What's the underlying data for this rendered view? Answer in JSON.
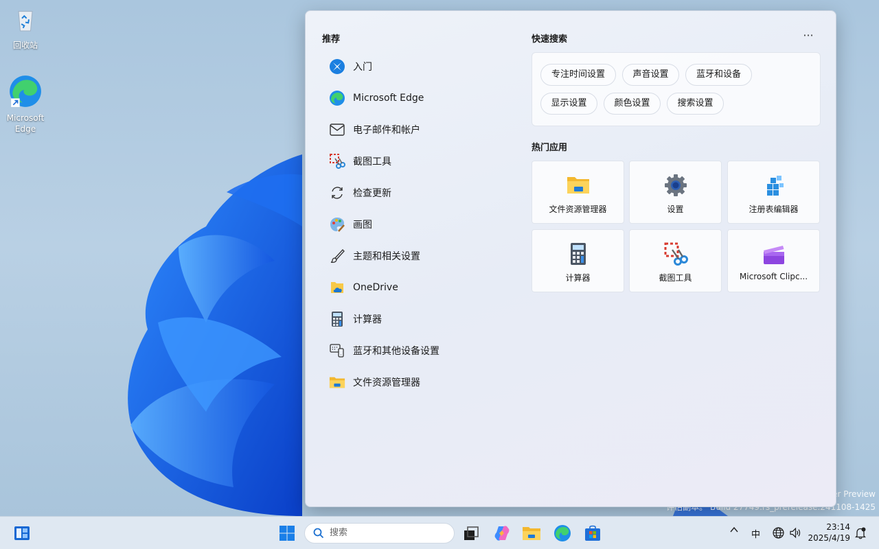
{
  "desktop": {
    "icons": [
      {
        "label": "回收站",
        "icon": "recycle-bin-icon"
      },
      {
        "label": "Microsoft Edge",
        "icon": "edge-shortcut-icon"
      }
    ],
    "watermark": {
      "line1": "er Preview",
      "line2": "评估副本。 Build 27749.rs_prerelease.241108-1425"
    }
  },
  "start_menu": {
    "recommended": {
      "title": "推荐",
      "items": [
        {
          "label": "入门",
          "icon": "get-started-icon"
        },
        {
          "label": "Microsoft Edge",
          "icon": "edge-icon"
        },
        {
          "label": "电子邮件和帐户",
          "icon": "mail-icon"
        },
        {
          "label": "截图工具",
          "icon": "snipping-tool-icon"
        },
        {
          "label": "检查更新",
          "icon": "refresh-icon"
        },
        {
          "label": "画图",
          "icon": "paint-icon"
        },
        {
          "label": "主题和相关设置",
          "icon": "brush-icon"
        },
        {
          "label": "OneDrive",
          "icon": "onedrive-icon"
        },
        {
          "label": "计算器",
          "icon": "calculator-icon"
        },
        {
          "label": "蓝牙和其他设备设置",
          "icon": "devices-icon"
        },
        {
          "label": "文件资源管理器",
          "icon": "folder-icon"
        }
      ]
    },
    "quick_search": {
      "title": "快速搜索",
      "more_label": "···",
      "pills": [
        "专注时间设置",
        "声音设置",
        "蓝牙和设备",
        "显示设置",
        "颜色设置",
        "搜索设置"
      ]
    },
    "hot_apps": {
      "title": "热门应用",
      "tiles": [
        {
          "label": "文件资源管理器",
          "icon": "folder-icon"
        },
        {
          "label": "设置",
          "icon": "gear-icon"
        },
        {
          "label": "注册表编辑器",
          "icon": "registry-editor-icon"
        },
        {
          "label": "计算器",
          "icon": "calculator-icon"
        },
        {
          "label": "截图工具",
          "icon": "snipping-tool-icon"
        },
        {
          "label": "Microsoft Clipc...",
          "icon": "clipchamp-icon"
        }
      ]
    }
  },
  "taskbar": {
    "search_placeholder": "搜索",
    "ime_label": "中",
    "time": "23:14",
    "date": "2025/4/19",
    "pinned": [
      "widgets-icon",
      "start-icon",
      "task-view-icon",
      "copilot-icon",
      "file-explorer-icon",
      "edge-icon",
      "store-icon"
    ]
  },
  "colors": {
    "accent": "#0078d4",
    "folder_yellow": "#f7c948"
  }
}
